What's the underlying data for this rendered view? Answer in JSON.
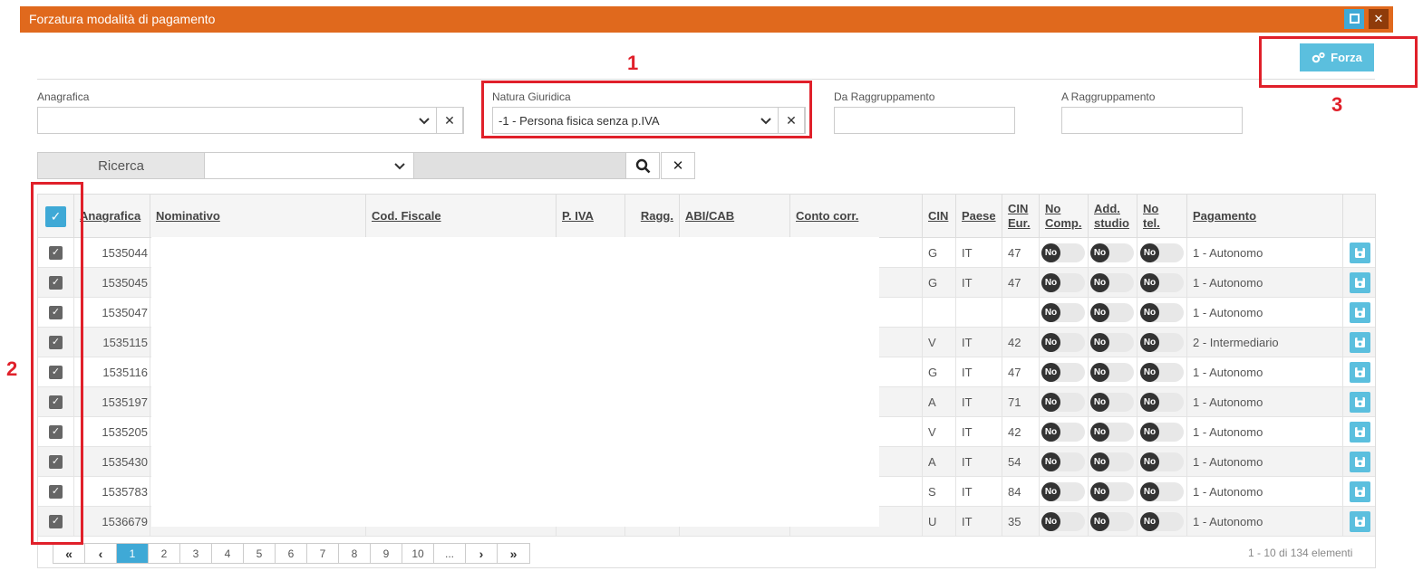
{
  "window": {
    "title": "Forzatura modalità di pagamento",
    "maximize_icon": "maximize-icon",
    "close_icon": "close-icon",
    "close_glyph": "✕"
  },
  "toolbar": {
    "forza_label": "Forza",
    "forza_icon": "gears-icon"
  },
  "filters": {
    "anagrafica": {
      "label": "Anagrafica",
      "value": ""
    },
    "natura_giuridica": {
      "label": "Natura Giuridica",
      "value": "-1 - Persona fisica senza p.IVA"
    },
    "da_raggruppamento": {
      "label": "Da Raggruppamento",
      "value": ""
    },
    "a_raggruppamento": {
      "label": "A Raggruppamento",
      "value": ""
    },
    "clear_glyph": "✕"
  },
  "search": {
    "label": "Ricerca",
    "value": "",
    "search_icon": "search-icon",
    "clear_glyph": "✕"
  },
  "grid": {
    "columns": [
      "Anagrafica",
      "Nominativo",
      "Cod. Fiscale",
      "P. IVA",
      "Ragg.",
      "ABI/CAB",
      "Conto corr.",
      "CIN",
      "Paese",
      "CIN Eur.",
      "No Comp.",
      "Add. studio",
      "No tel.",
      "Pagamento"
    ],
    "header_check_glyph": "✓",
    "row_check_glyph": "✓",
    "toggle_label": "No",
    "rows": [
      {
        "anagrafica": "1535044",
        "cin": "G",
        "paese": "IT",
        "cin_eur": "47",
        "pagamento": "1 - Autonomo"
      },
      {
        "anagrafica": "1535045",
        "cin": "G",
        "paese": "IT",
        "cin_eur": "47",
        "pagamento": "1 - Autonomo"
      },
      {
        "anagrafica": "1535047",
        "cin": "",
        "paese": "",
        "cin_eur": "",
        "pagamento": "1 - Autonomo"
      },
      {
        "anagrafica": "1535115",
        "cin": "V",
        "paese": "IT",
        "cin_eur": "42",
        "pagamento": "2 - Intermediario"
      },
      {
        "anagrafica": "1535116",
        "cin": "G",
        "paese": "IT",
        "cin_eur": "47",
        "pagamento": "1 - Autonomo"
      },
      {
        "anagrafica": "1535197",
        "cin": "A",
        "paese": "IT",
        "cin_eur": "71",
        "pagamento": "1 - Autonomo"
      },
      {
        "anagrafica": "1535205",
        "cin": "V",
        "paese": "IT",
        "cin_eur": "42",
        "pagamento": "1 - Autonomo"
      },
      {
        "anagrafica": "1535430",
        "cin": "A",
        "paese": "IT",
        "cin_eur": "54",
        "pagamento": "1 - Autonomo"
      },
      {
        "anagrafica": "1535783",
        "cin": "S",
        "paese": "IT",
        "cin_eur": "84",
        "pagamento": "1 - Autonomo"
      },
      {
        "anagrafica": "1536679",
        "cin": "U",
        "paese": "IT",
        "cin_eur": "35",
        "pagamento": "1 - Autonomo"
      }
    ]
  },
  "pagination": {
    "first": "«",
    "prev": "‹",
    "next": "›",
    "last": "»",
    "pages": [
      "1",
      "2",
      "3",
      "4",
      "5",
      "6",
      "7",
      "8",
      "9",
      "10",
      "..."
    ],
    "active_page": "1",
    "info": "1 - 10 di 134 elementi"
  },
  "annotations": {
    "one": "1",
    "two": "2",
    "three": "3",
    "color": "#e0202a"
  },
  "colors": {
    "titlebar": "#e0691d",
    "accent": "#3fa9d6",
    "button": "#5bbfde"
  }
}
